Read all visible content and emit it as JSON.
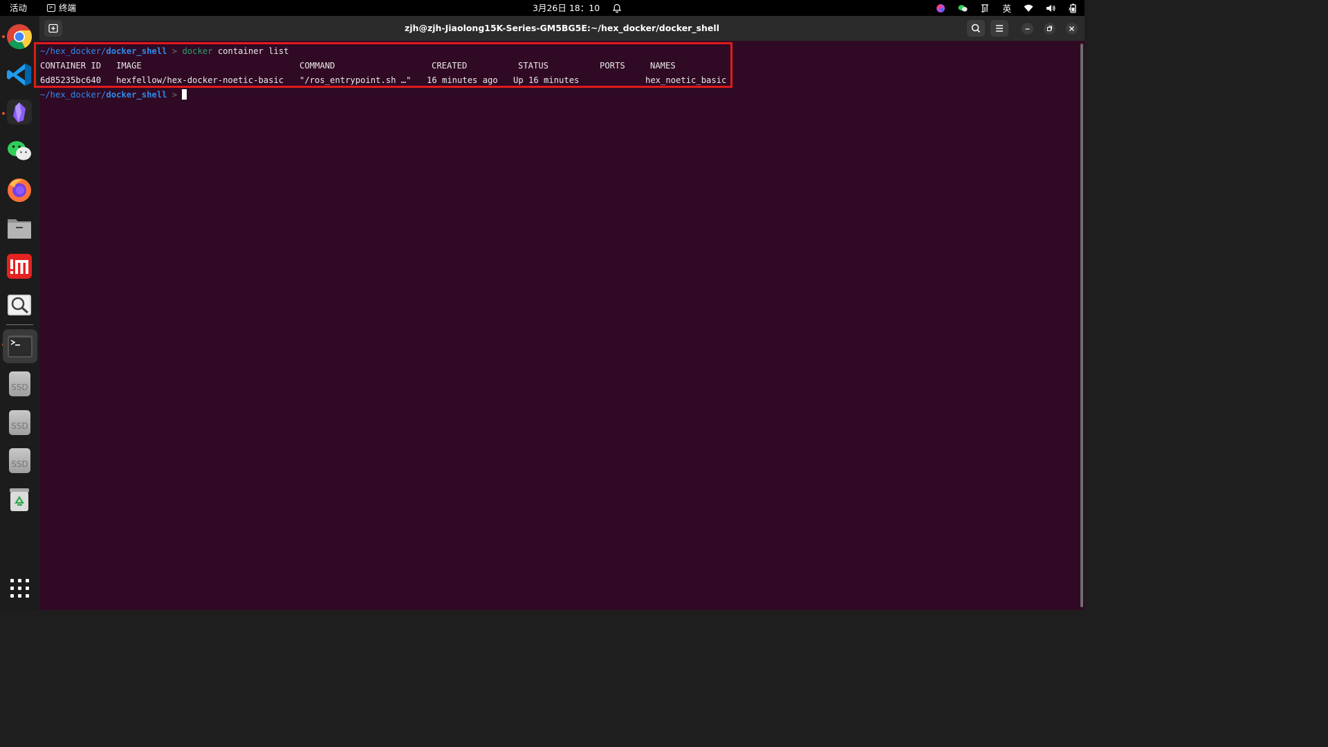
{
  "topbar": {
    "activities": "活动",
    "app_name": "终端",
    "clock": "3月26日  18：10",
    "lang": "英"
  },
  "window": {
    "title": "zjh@zjh-Jiaolong15K-Series-GM5BG5E:~/hex_docker/docker_shell"
  },
  "terminal": {
    "prompt1": {
      "path_prefix": "~/hex_docker/",
      "path_dir": "docker_shell",
      "arrow": " > ",
      "cmd_name": "docker",
      "cmd_args": " container list"
    },
    "headers": [
      "CONTAINER ID",
      "IMAGE",
      "COMMAND",
      "CREATED",
      "STATUS",
      "PORTS",
      "NAMES"
    ],
    "row": [
      "6d85235bc640",
      "hexfellow/hex-docker-noetic-basic",
      "\"/ros_entrypoint.sh …\"",
      "16 minutes ago",
      "Up 16 minutes",
      "",
      "hex_noetic_basic"
    ],
    "prompt2": {
      "path_prefix": "~/hex_docker/",
      "path_dir": "docker_shell",
      "arrow": " > "
    }
  },
  "dock": {
    "items": [
      "chrome-icon",
      "vscode-icon",
      "obsidian-icon",
      "wechat-icon",
      "firefox-icon",
      "files-icon",
      "mindmaster-icon",
      "image-viewer-icon",
      "terminal-icon",
      "ssd-drive-icon",
      "ssd-drive-icon",
      "ssd-drive-icon",
      "trash-icon",
      "show-apps-icon"
    ],
    "ssd_label": "SSD"
  },
  "colors": {
    "terminal_bg": "#300a24",
    "path": "#2d8be8",
    "docker_cmd": "#26a269",
    "highlight": "#e01b1b",
    "accent_dot": "#e95420"
  }
}
